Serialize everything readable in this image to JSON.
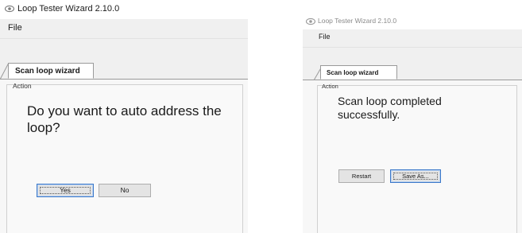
{
  "left_window": {
    "title": "Loop Tester Wizard 2.10.0",
    "menu": {
      "file": "File"
    },
    "tab": {
      "label": "Scan loop wizard"
    },
    "group": {
      "label": "Action"
    },
    "message": "Do you want to auto address the loop?",
    "buttons": {
      "yes": "Yes",
      "no": "No"
    }
  },
  "right_window": {
    "title": "Loop Tester Wizard 2.10.0",
    "menu": {
      "file": "File"
    },
    "tab": {
      "label": "Scan loop wizard"
    },
    "group": {
      "label": "Action"
    },
    "message": "Scan loop completed successfully.",
    "buttons": {
      "restart": "Restart",
      "save_as": "Save As..."
    }
  },
  "colors": {
    "focus_border": "#3b78c9",
    "button_face": "#e4e4e4",
    "panel_border": "#d0d0d0"
  },
  "icons": {
    "app_icon": "eye-icon"
  }
}
